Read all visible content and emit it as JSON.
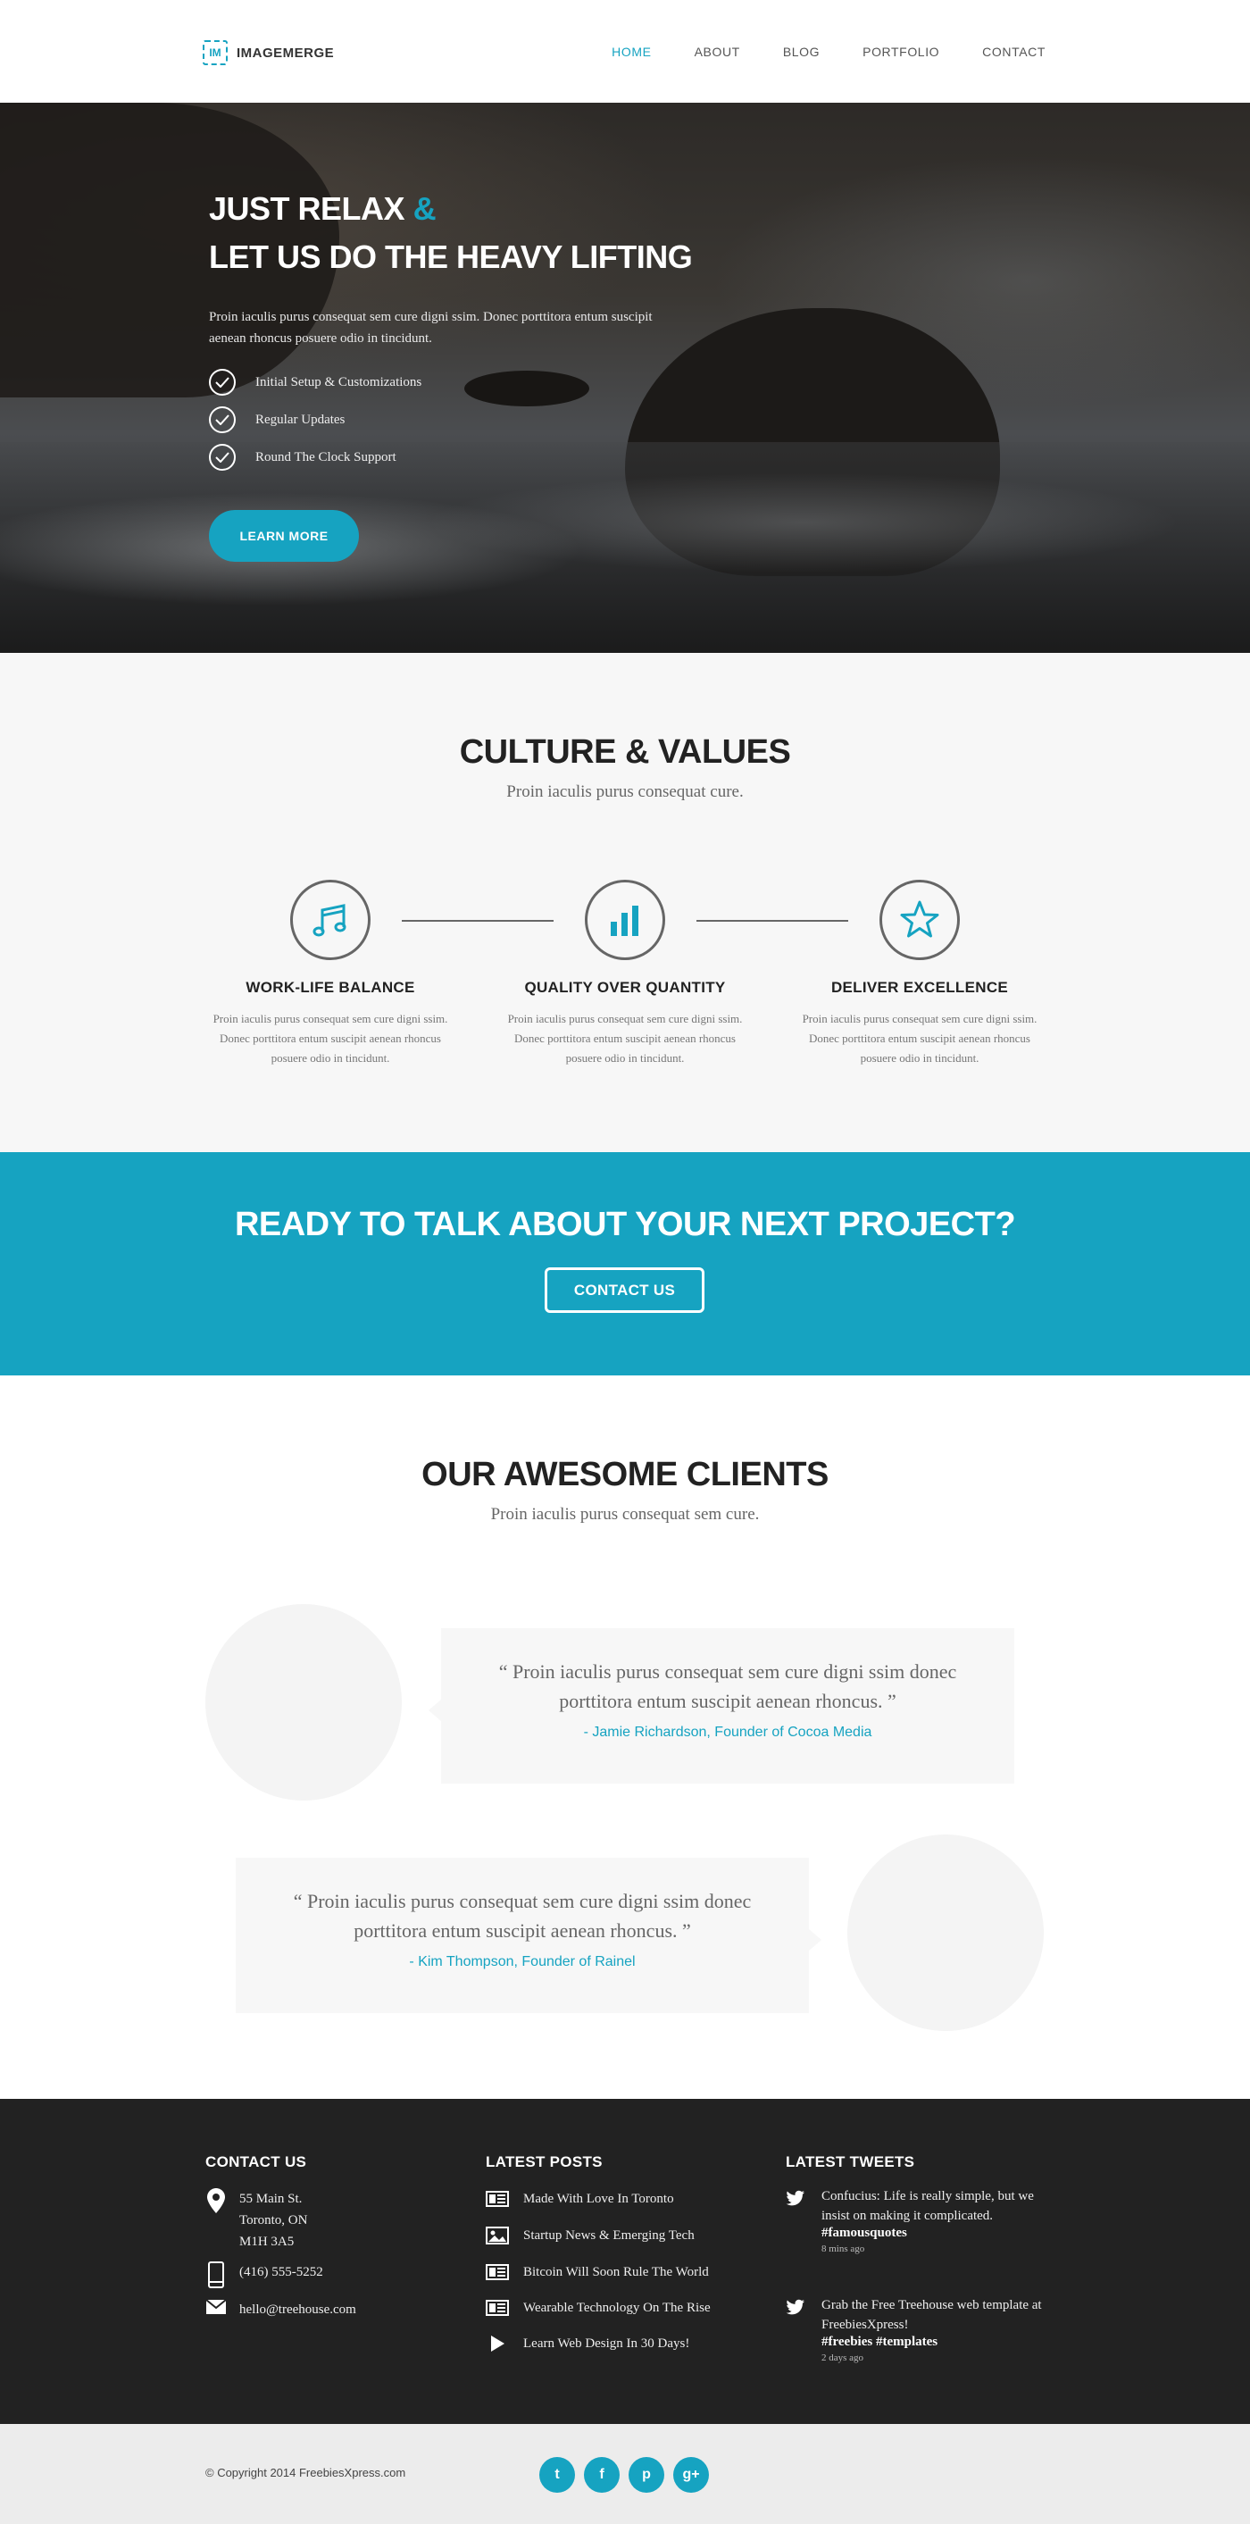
{
  "header": {
    "logo_mark": "IM",
    "logo_text": "IMAGEMERGE",
    "nav": [
      "HOME",
      "ABOUT",
      "BLOG",
      "PORTFOLIO",
      "CONTACT"
    ],
    "active_nav": "HOME"
  },
  "hero": {
    "title_line1": "JUST RELAX",
    "title_amp": "&",
    "title_line2": "LET US DO THE HEAVY LIFTING",
    "description": "Proin iaculis purus consequat sem cure  digni ssim. Donec porttitora entum suscipit  aenean rhoncus posuere odio in tincidunt.",
    "checks": [
      "Initial Setup & Customizations",
      "Regular Updates",
      "Round The Clock Support"
    ],
    "button": "LEARN MORE"
  },
  "culture": {
    "title": "CULTURE & VALUES",
    "subtitle": "Proin iaculis purus consequat cure.",
    "values": [
      {
        "icon": "music-note-icon",
        "title": "WORK-LIFE BALANCE",
        "desc": "Proin iaculis purus consequat sem cure digni ssim. Donec porttitora entum suscipit aenean rhoncus posuere odio in tincidunt."
      },
      {
        "icon": "bar-chart-icon",
        "title": "QUALITY OVER QUANTITY",
        "desc": "Proin iaculis purus consequat sem cure digni ssim. Donec porttitora entum suscipit aenean rhoncus posuere odio in tincidunt."
      },
      {
        "icon": "star-icon",
        "title": "DELIVER EXCELLENCE",
        "desc": "Proin iaculis purus consequat sem cure digni ssim. Donec porttitora entum suscipit aenean rhoncus posuere odio in tincidunt."
      }
    ]
  },
  "cta": {
    "title": "READY TO TALK ABOUT YOUR NEXT PROJECT?",
    "button": "CONTACT US"
  },
  "clients": {
    "title": "OUR AWESOME CLIENTS",
    "subtitle": "Proin iaculis purus consequat sem cure.",
    "testimonials": [
      {
        "quote": "“ Proin iaculis purus consequat sem cure  digni ssim donec porttitora entum suscipit aenean rhoncus. ”",
        "author": "- Jamie Richardson, Founder of Cocoa Media"
      },
      {
        "quote": "“ Proin iaculis purus consequat sem cure  digni ssim donec porttitora entum suscipit aenean rhoncus. ”",
        "author": "- Kim Thompson, Founder of Rainel"
      }
    ]
  },
  "footer": {
    "contact_title": "CONTACT US",
    "address": [
      "55 Main St.",
      "Toronto, ON",
      "M1H 3A5"
    ],
    "phone": "(416) 555-5252",
    "email": "hello@treehouse.com",
    "posts_title": "LATEST POSTS",
    "posts": [
      {
        "icon": "article-icon",
        "label": "Made With Love In Toronto"
      },
      {
        "icon": "image-icon",
        "label": "Startup News & Emerging Tech"
      },
      {
        "icon": "article-icon",
        "label": "Bitcoin Will Soon Rule The World"
      },
      {
        "icon": "article-icon",
        "label": "Wearable Technology On The Rise"
      },
      {
        "icon": "play-icon",
        "label": "Learn Web Design In 30 Days!"
      }
    ],
    "tweets_title": "LATEST TWEETS",
    "tweets": [
      {
        "text": "Confucius: Life is really simple, but we insist on making it complicated.",
        "tags": "#famousquotes",
        "time": "8 mins ago"
      },
      {
        "text": "Grab the Free Treehouse web template at FreebiesXpress!",
        "tags": "#freebies #templates",
        "time": "2 days ago"
      }
    ],
    "copyright": "© Copyright 2014 FreebiesXpress.com",
    "social": [
      {
        "icon": "twitter-icon",
        "glyph": "t"
      },
      {
        "icon": "facebook-icon",
        "glyph": "f"
      },
      {
        "icon": "pinterest-icon",
        "glyph": "p"
      },
      {
        "icon": "google-plus-icon",
        "glyph": "g+"
      }
    ]
  },
  "colors": {
    "accent": "#16a3c1",
    "dark_footer": "#222222",
    "light_section": "#f7f7f7"
  }
}
